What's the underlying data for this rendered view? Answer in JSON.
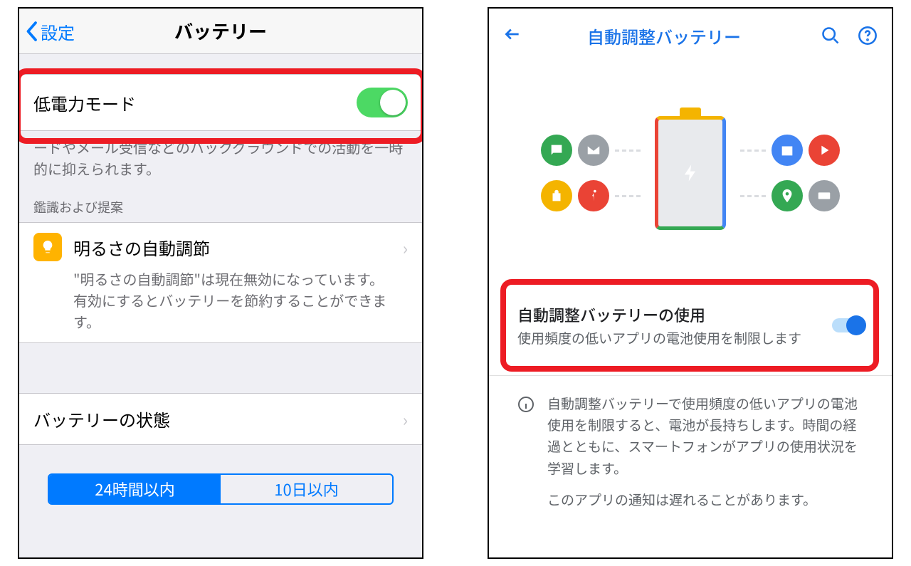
{
  "ios": {
    "back_label": "設定",
    "title": "バッテリー",
    "low_power_label": "低電力モード",
    "low_power_on": true,
    "low_power_desc": "ードやメール受信などのバックグラウンドでの活動を一時的に抑えられます。",
    "suggestions_header": "鑑識および提案",
    "suggestion": {
      "icon_name": "bulb-icon",
      "title": "明るさの自動調節",
      "subtitle": "\"明るさの自動調節\"は現在無効になっています。有効にするとバッテリーを節約することができます。"
    },
    "health_label": "バッテリーの状態",
    "segments": [
      "24時間以内",
      "10日以内"
    ],
    "segment_active": 0
  },
  "android": {
    "title": "自動調整バッテリー",
    "toggle_title": "自動調整バッテリーの使用",
    "toggle_subtitle": "使用頻度の低いアプリの電池使用を制限します",
    "toggle_on": true,
    "info_para1": "自動調整バッテリーで使用頻度の低いアプリの電池使用を制限すると、電池が長持ちします。時間の経過とともに、スマートフォンがアプリの使用状況を学習します。",
    "info_para2": "このアプリの通知は遅れることがあります。",
    "illustration_icons": [
      {
        "name": "chat-icon",
        "color": "#34a853"
      },
      {
        "name": "mail-icon",
        "color": "#5f6368"
      },
      {
        "name": "bag-icon",
        "color": "#f4b400"
      },
      {
        "name": "run-icon",
        "color": "#ea4335"
      },
      {
        "name": "calendar-icon",
        "color": "#4285f4"
      },
      {
        "name": "play-icon",
        "color": "#ea4335"
      },
      {
        "name": "pin-icon",
        "color": "#34a853"
      },
      {
        "name": "card-icon",
        "color": "#5f6368"
      }
    ]
  },
  "colors": {
    "ios_blue": "#007aff",
    "ios_green": "#4cd964",
    "android_blue": "#1a73e8",
    "highlight_red": "#ed1c24"
  }
}
